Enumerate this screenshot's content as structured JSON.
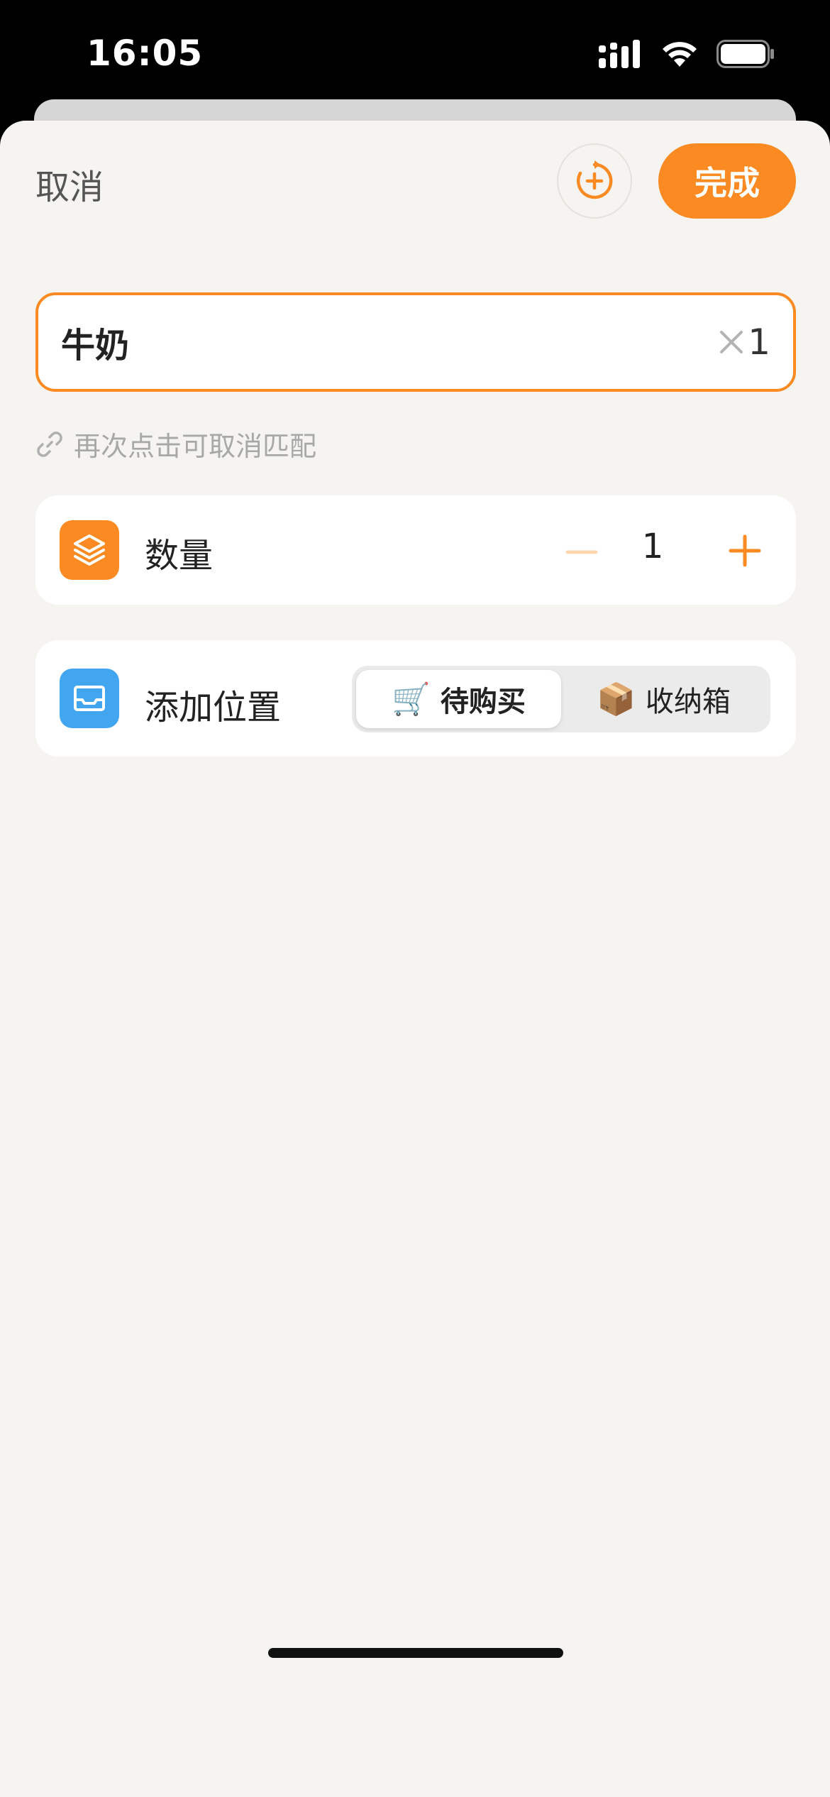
{
  "status_bar": {
    "time": "16:05",
    "icons": [
      "signal-icon",
      "wifi-icon",
      "battery-icon"
    ]
  },
  "header": {
    "cancel_label": "取消",
    "add_again_icon": "add-again-icon",
    "done_label": "完成"
  },
  "name_field": {
    "value": "牛奶",
    "clear_icon": "close-icon",
    "quantity_suffix": "1"
  },
  "hint": {
    "icon": "link-icon",
    "text": "再次点击可取消匹配"
  },
  "quantity_card": {
    "icon": "layers-icon",
    "label": "数量",
    "value": "1",
    "minus_icon": "minus-icon",
    "plus_icon": "plus-icon"
  },
  "location_card": {
    "icon": "tray-icon",
    "label": "添加位置",
    "options": [
      {
        "emoji": "🛒",
        "label": "待购买",
        "selected": true
      },
      {
        "emoji": "📦",
        "label": "收纳箱",
        "selected": false
      }
    ]
  },
  "colors": {
    "accent": "#fb8a22",
    "accent_light": "#fcd7b0",
    "location_icon_bg": "#41a6ef",
    "sheet_bg": "#f5f4f1"
  }
}
